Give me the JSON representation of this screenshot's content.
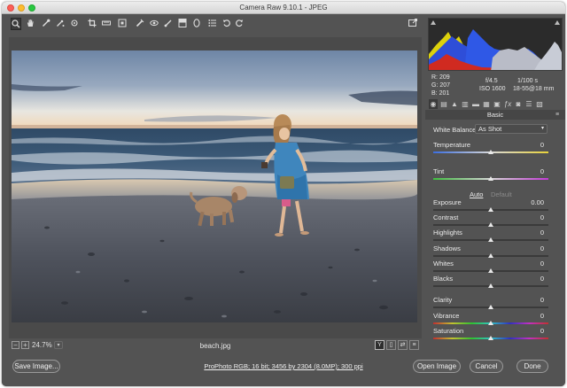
{
  "window": {
    "title": "Camera Raw 9.10.1  -  JPEG"
  },
  "toolbar": {
    "tools": [
      "zoom-icon",
      "hand-icon",
      "white-balance-eyedropper-icon",
      "color-sampler-icon",
      "target-adjust-icon",
      "crop-icon",
      "straighten-icon",
      "spot-removal-icon",
      "red-eye-icon",
      "adjustment-brush-icon",
      "graduated-filter-icon",
      "radial-filter-icon",
      "preferences-icon",
      "rotate-ccw-icon",
      "rotate-cw-icon"
    ],
    "active_tool": "zoom-icon"
  },
  "image": {
    "filename": "beach.jpg",
    "zoom_level": "24.7%"
  },
  "readout": {
    "r_label": "R:",
    "r_value": "209",
    "g_label": "G:",
    "g_value": "207",
    "b_label": "B:",
    "b_value": "201",
    "aperture": "f/4.5",
    "shutter": "1/100 s",
    "iso": "ISO 1600",
    "lens": "18-55@18 mm"
  },
  "panel": {
    "title": "Basic"
  },
  "white_balance": {
    "label": "White Balance:",
    "value": "As Shot"
  },
  "auto_label": "Auto",
  "default_label": "Default",
  "sliders": [
    {
      "label": "Temperature",
      "value": "0",
      "position": 0.5,
      "track": "temp"
    },
    {
      "label": "Tint",
      "value": "0",
      "position": 0.5,
      "track": "tint"
    },
    {
      "label": "Exposure",
      "value": "0.00",
      "position": 0.5,
      "track": "plain"
    },
    {
      "label": "Contrast",
      "value": "0",
      "position": 0.5,
      "track": "plain"
    },
    {
      "label": "Highlights",
      "value": "0",
      "position": 0.5,
      "track": "plain"
    },
    {
      "label": "Shadows",
      "value": "0",
      "position": 0.5,
      "track": "plain"
    },
    {
      "label": "Whites",
      "value": "0",
      "position": 0.5,
      "track": "plain"
    },
    {
      "label": "Blacks",
      "value": "0",
      "position": 0.5,
      "track": "plain"
    },
    {
      "label": "Clarity",
      "value": "0",
      "position": 0.5,
      "track": "plain"
    },
    {
      "label": "Vibrance",
      "value": "0",
      "position": 0.5,
      "track": "color"
    },
    {
      "label": "Saturation",
      "value": "0",
      "position": 0.5,
      "track": "color"
    }
  ],
  "footer": {
    "save_label": "Save Image...",
    "workflow_label": "ProPhoto RGB; 16 bit; 3456 by 2304 (8.0MP); 300 ppi",
    "open_label": "Open Image",
    "cancel_label": "Cancel",
    "done_label": "Done"
  },
  "colors": {
    "panel_bg": "#535353",
    "histogram_bg": "#2b2b2b"
  }
}
